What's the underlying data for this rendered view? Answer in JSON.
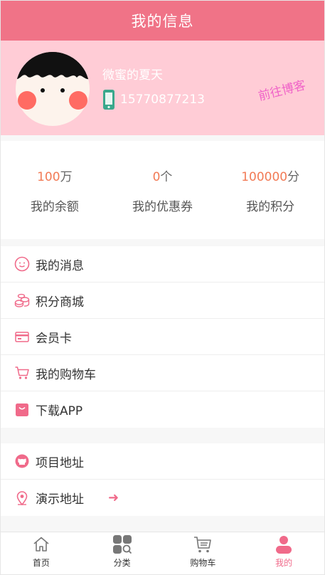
{
  "header": {
    "title": "我的信息"
  },
  "profile": {
    "nickname": "微蜜的夏天",
    "phone": "15770877213",
    "blog_link": "前往博客"
  },
  "stats": [
    {
      "value": "100",
      "unit": "万",
      "label": "我的余额"
    },
    {
      "value": "0",
      "unit": "个",
      "label": "我的优惠券"
    },
    {
      "value": "100000",
      "unit": "分",
      "label": "我的积分"
    }
  ],
  "menu_group_1": [
    {
      "label": "我的消息",
      "icon": "message-icon"
    },
    {
      "label": "积分商城",
      "icon": "coins-icon"
    },
    {
      "label": "会员卡",
      "icon": "card-icon"
    },
    {
      "label": "我的购物车",
      "icon": "cart-icon"
    },
    {
      "label": "下载APP",
      "icon": "bag-icon"
    }
  ],
  "menu_group_2": [
    {
      "label": "项目地址",
      "icon": "github-icon"
    },
    {
      "label": "演示地址",
      "icon": "location-icon"
    }
  ],
  "tabbar": [
    {
      "label": "首页",
      "icon": "home-icon"
    },
    {
      "label": "分类",
      "icon": "category-icon"
    },
    {
      "label": "购物车",
      "icon": "shopping-cart-icon"
    },
    {
      "label": "我的",
      "icon": "user-icon",
      "active": true
    }
  ],
  "colors": {
    "header_bg": "#f07387",
    "profile_bg": "#ffccd6",
    "accent": "#f06a8a",
    "stat_value": "#f27a55",
    "blog_link": "#f063c8"
  }
}
